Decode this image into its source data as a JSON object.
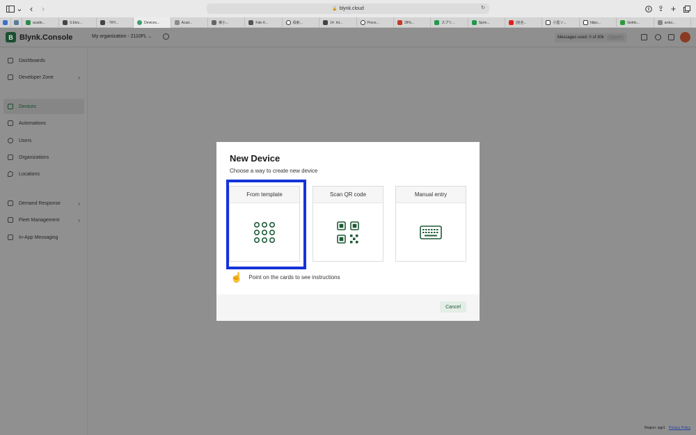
{
  "browser": {
    "url": "blynk.cloud",
    "tabs": [
      {
        "label": ""
      },
      {
        "label": ""
      },
      {
        "label": "acade..."
      },
      {
        "label": "6.Elec..."
      },
      {
        "label": "- TRY..."
      },
      {
        "label": "Devices..."
      },
      {
        "label": "Acad..."
      },
      {
        "label": "被小..."
      },
      {
        "label": "Fab-X..."
      },
      {
        "label": "役射..."
      },
      {
        "label": "14. Int..."
      },
      {
        "label": "Proce..."
      },
      {
        "label": "28%..."
      },
      {
        "label": "スプリ..."
      },
      {
        "label": "Sprin..."
      },
      {
        "label": "[完全..."
      },
      {
        "label": "小型ソ..."
      },
      {
        "label": "https..."
      },
      {
        "label": "Gettin..."
      },
      {
        "label": "ardui..."
      }
    ]
  },
  "app": {
    "logo_letter": "B",
    "name": "Blynk.Console",
    "org": "My organization - 2110FL",
    "messages": "Messages used: 0 of 30k",
    "upgrade": "Upgrade"
  },
  "sidebar": {
    "items": [
      {
        "label": "Dashboards"
      },
      {
        "label": "Developer Zone"
      },
      {
        "label": "Devices"
      },
      {
        "label": "Automations"
      },
      {
        "label": "Users"
      },
      {
        "label": "Organizations"
      },
      {
        "label": "Locations"
      },
      {
        "label": "Demand Response"
      },
      {
        "label": "Fleet Management"
      },
      {
        "label": "In-App Messaging"
      }
    ]
  },
  "footer": {
    "region": "Region: sgp1",
    "privacy": "Privacy Policy"
  },
  "modal": {
    "title": "New Device",
    "subtitle": "Choose a way to create new device",
    "cards": [
      {
        "label": "From template",
        "icon": "grid-icon"
      },
      {
        "label": "Scan QR code",
        "icon": "qr-code-icon"
      },
      {
        "label": "Manual entry",
        "icon": "keyboard-icon"
      }
    ],
    "hint": "Point on the cards to see instructions",
    "cancel": "Cancel"
  },
  "colors": {
    "accent": "#1d5a35",
    "highlight": "#1433d8"
  }
}
